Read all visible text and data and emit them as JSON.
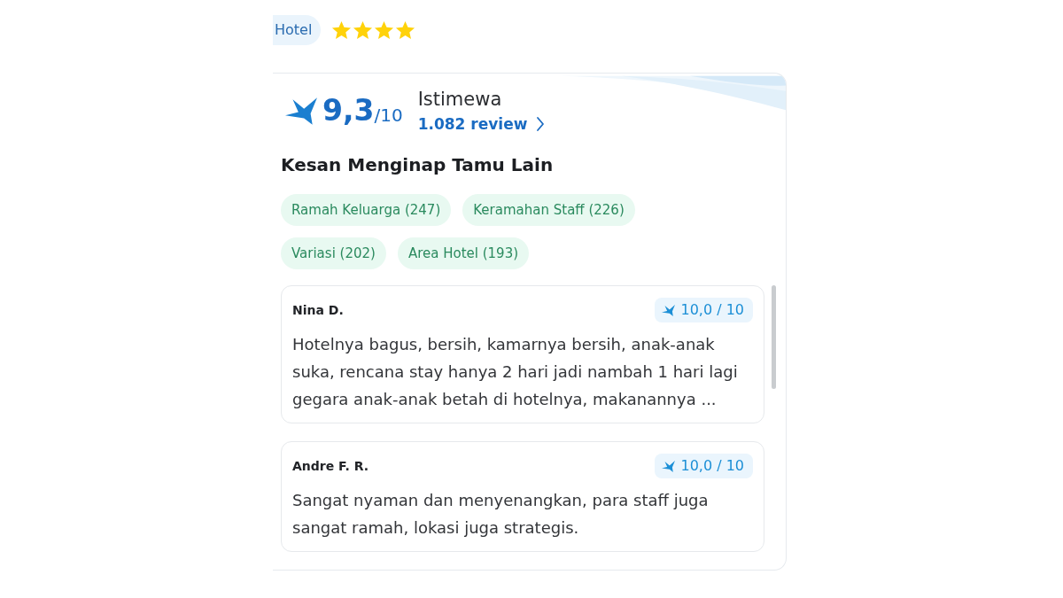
{
  "property": {
    "type_badge": "Hotel",
    "stars": 4
  },
  "rating": {
    "score": "9,3",
    "scale": "/10",
    "label": "Istimewa",
    "review_link": "1.082 review"
  },
  "impressions": {
    "title": "Kesan Menginap Tamu Lain",
    "tags": [
      "Ramah Keluarga (247)",
      "Keramahan Staff (226)",
      "Variasi (202)",
      "Area Hotel (193)"
    ]
  },
  "reviews": [
    {
      "name": "Nina D.",
      "score": "10,0 / 10",
      "text": "Hotelnya bagus, bersih, kamarnya bersih, anak-anak suka, rencana stay hanya 2 hari jadi nambah 1 hari lagi gegara anak-anak betah di hotelnya, makanannya ..."
    },
    {
      "name": "Andre F. R.",
      "score": "10,0 / 10",
      "text": "Sangat nyaman dan menyenangkan, para staff juga sangat ramah, lokasi juga strategis."
    }
  ]
}
